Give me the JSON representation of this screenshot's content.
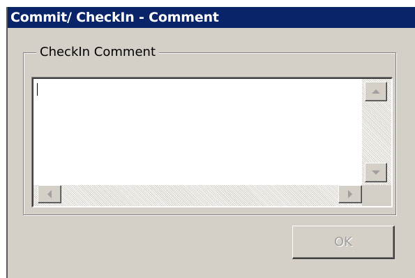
{
  "window": {
    "title": "Commit/ CheckIn - Comment"
  },
  "group": {
    "label": "CheckIn Comment"
  },
  "comment": {
    "value": ""
  },
  "buttons": {
    "ok_label": "OK"
  },
  "icons": {
    "scroll_up": "arrow-up-icon",
    "scroll_down": "arrow-down-icon",
    "scroll_left": "arrow-left-icon",
    "scroll_right": "arrow-right-icon"
  },
  "colors": {
    "titlebar": "#0a246a",
    "dialog_bg": "#d4d0c8",
    "disabled_text": "#a0a0a0"
  }
}
